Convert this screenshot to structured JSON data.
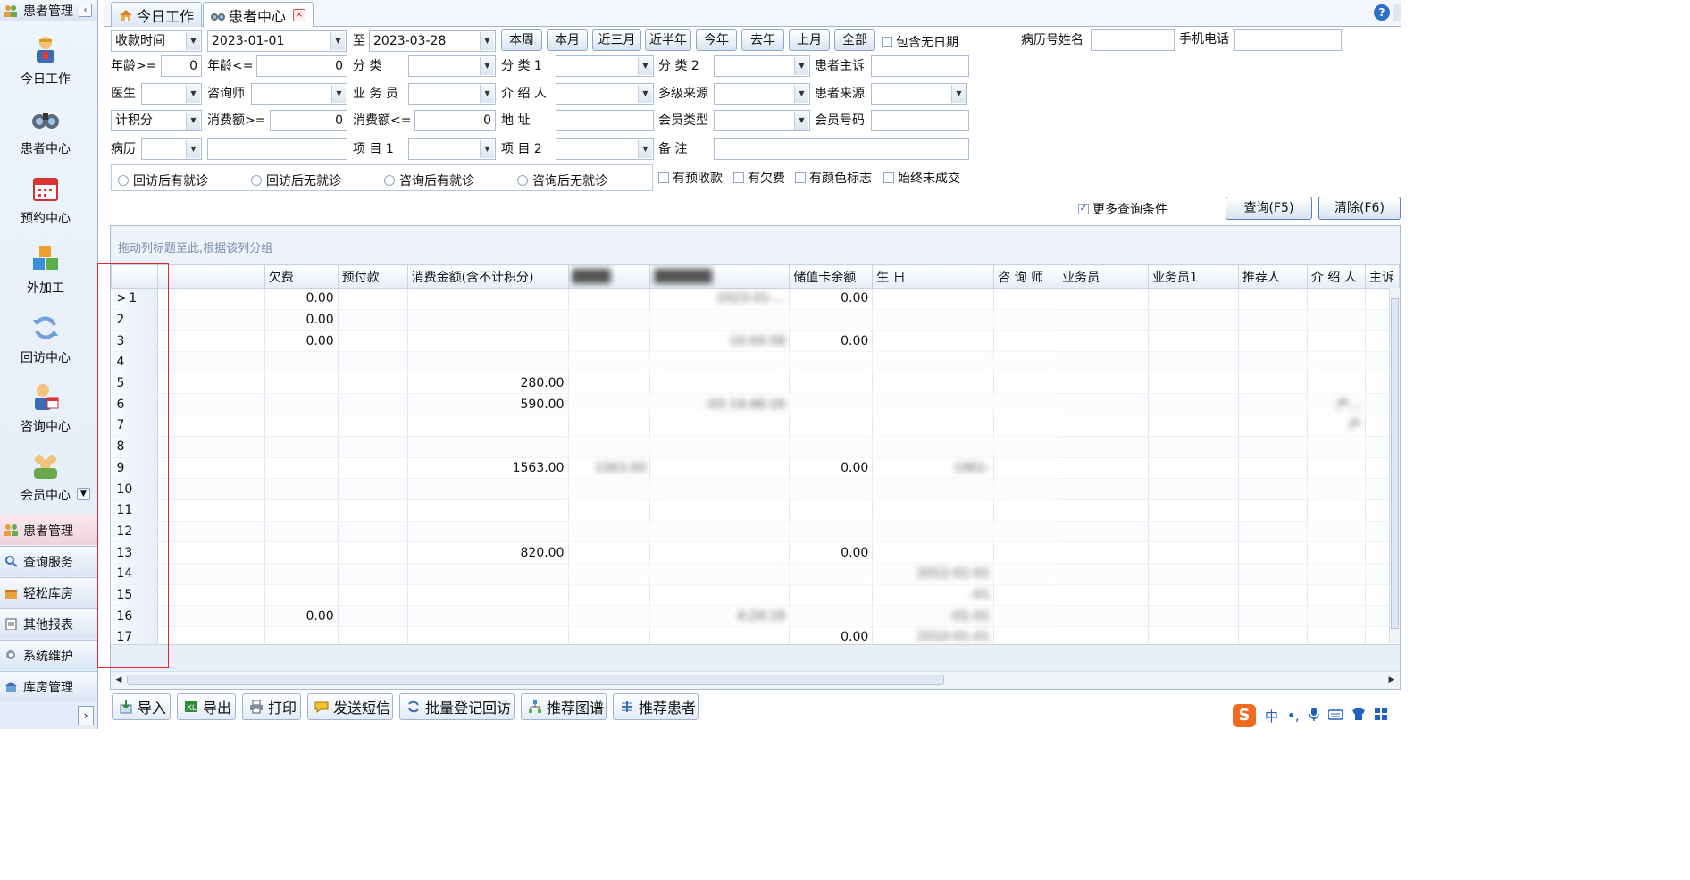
{
  "sidebar": {
    "title": "患者管理",
    "collapse_glyph": "‹",
    "big_items": [
      {
        "label": "今日工作",
        "icon": "worker-icon"
      },
      {
        "label": "患者中心",
        "icon": "binoculars-icon"
      },
      {
        "label": "预约中心",
        "icon": "calendar-icon"
      },
      {
        "label": "外加工",
        "icon": "cubes-icon"
      },
      {
        "label": "回访中心",
        "icon": "refresh-icon"
      },
      {
        "label": "咨询中心",
        "icon": "consultant-icon"
      },
      {
        "label": "会员中心",
        "icon": "members-icon"
      }
    ],
    "sections": [
      {
        "label": "患者管理",
        "active": true
      },
      {
        "label": "查询服务",
        "active": false
      },
      {
        "label": "轻松库房",
        "active": false
      },
      {
        "label": "其他报表",
        "active": false
      },
      {
        "label": "系统维护",
        "active": false
      },
      {
        "label": "库房管理",
        "active": false
      }
    ]
  },
  "tabs": [
    {
      "label": "今日工作",
      "icon": "home-icon",
      "active": false
    },
    {
      "label": "患者中心",
      "icon": "binoculars-icon",
      "active": true,
      "close_glyph": "×"
    }
  ],
  "help_glyph": "?",
  "query": {
    "date_type": "收款时间",
    "date_from": "2023-01-01",
    "to_label": "至",
    "date_to": "2023-03-28",
    "quick_ranges": [
      "本周",
      "本月",
      "近三月",
      "近半年",
      "今年",
      "去年",
      "上月",
      "全部"
    ],
    "include_no_date_label": "包含无日期",
    "record_name_label": "病历号姓名",
    "record_name_value": "",
    "phone_label": "手机电话",
    "phone_value": "",
    "age_gte_label": "年龄>=",
    "age_gte_value": "0",
    "age_lte_label": "年龄<=",
    "age_lte_value": "0",
    "category_label": "分  类",
    "category1_label": "分 类 1",
    "category2_label": "分 类 2",
    "complaint_label": "患者主诉",
    "doctor_label": "医生",
    "consultant_label": "咨询师",
    "salesman_label": "业 务 员",
    "referrer_label": "介 绍 人",
    "multi_source_label": "多级来源",
    "patient_source_label": "患者来源",
    "points_type": "计积分",
    "spend_gte_label": "消费额>=",
    "spend_gte_value": "0",
    "spend_lte_label": "消费额<=",
    "spend_lte_value": "0",
    "address_label": "地  址",
    "member_type_label": "会员类型",
    "member_no_label": "会员号码",
    "record_label": "病历",
    "item1_label": "项 目 1",
    "item2_label": "项 目 2",
    "remark_label": "备  注",
    "radios": [
      "回访后有就诊",
      "回访后无就诊",
      "咨询后有就诊",
      "咨询后无就诊"
    ],
    "flags": [
      "有预收款",
      "有欠费",
      "有颜色标志",
      "始终未成交"
    ],
    "more_conditions_label": "更多查询条件",
    "more_conditions_checked": "✓",
    "search_button": "查询(F5)",
    "clear_button": "清除(F6)"
  },
  "grid": {
    "group_hint": "拖动列标题至此,根据该列分组",
    "columns": [
      "",
      "",
      "欠费",
      "预付款",
      "消费金额(含不计积分)",
      "",
      "",
      "储值卡余额",
      "生  日",
      "咨 询 师",
      "业务员",
      "业务员1",
      "推荐人",
      "介 绍 人",
      "主诉"
    ],
    "current_row_marker": ">",
    "rows": [
      {
        "n": "1",
        "owe": "0.00",
        "prepay": "",
        "spend": "",
        "c5": "",
        "c6": "2023-01-...",
        "card": "0.00",
        "birthday": "",
        "consultant": "",
        "referrer": ""
      },
      {
        "n": "2",
        "owe": "0.00",
        "prepay": "",
        "spend": "",
        "c5": "",
        "c6": "",
        "card": "",
        "birthday": "",
        "consultant": "",
        "referrer": ""
      },
      {
        "n": "3",
        "owe": "0.00",
        "prepay": "",
        "spend": "",
        "c5": "",
        "c6": "10:44:58",
        "card": "0.00",
        "birthday": "",
        "consultant": "",
        "referrer": ""
      },
      {
        "n": "4",
        "owe": "",
        "prepay": "",
        "spend": "",
        "c5": "",
        "c6": "",
        "card": "",
        "birthday": "",
        "consultant": "",
        "referrer": ""
      },
      {
        "n": "5",
        "owe": "",
        "prepay": "",
        "spend": "280.00",
        "c5": "",
        "c6": "",
        "card": "",
        "birthday": "",
        "consultant": "",
        "referrer": ""
      },
      {
        "n": "6",
        "owe": "",
        "prepay": "",
        "spend": "590.00",
        "c5": "",
        "c6": "-03 14:46:16",
        "card": "",
        "birthday": "",
        "consultant": "",
        "referrer": "产..."
      },
      {
        "n": "7",
        "owe": "",
        "prepay": "",
        "spend": "",
        "c5": "",
        "c6": "",
        "card": "",
        "birthday": "",
        "consultant": "",
        "referrer": "产"
      },
      {
        "n": "8",
        "owe": "",
        "prepay": "",
        "spend": "",
        "c5": "",
        "c6": "",
        "card": "",
        "birthday": "",
        "consultant": "",
        "referrer": ""
      },
      {
        "n": "9",
        "owe": "",
        "prepay": "",
        "spend": "1563.00",
        "c5": "1563.00",
        "c6": "",
        "card": "0.00",
        "birthday": "1961-",
        "consultant": "",
        "referrer": ""
      },
      {
        "n": "10",
        "owe": "",
        "prepay": "",
        "spend": "",
        "c5": "",
        "c6": "",
        "card": "",
        "birthday": "",
        "consultant": "",
        "referrer": ""
      },
      {
        "n": "11",
        "owe": "",
        "prepay": "",
        "spend": "",
        "c5": "",
        "c6": "",
        "card": "",
        "birthday": "",
        "consultant": "",
        "referrer": ""
      },
      {
        "n": "12",
        "owe": "",
        "prepay": "",
        "spend": "",
        "c5": "",
        "c6": "",
        "card": "",
        "birthday": "",
        "consultant": "",
        "referrer": ""
      },
      {
        "n": "13",
        "owe": "",
        "prepay": "",
        "spend": "820.00",
        "c5": "",
        "c6": "",
        "card": "0.00",
        "birthday": "",
        "consultant": "",
        "referrer": ""
      },
      {
        "n": "14",
        "owe": "",
        "prepay": "",
        "spend": "",
        "c5": "",
        "c6": "",
        "card": "",
        "birthday": "2012-01-01",
        "consultant": "",
        "referrer": ""
      },
      {
        "n": "15",
        "owe": "",
        "prepay": "",
        "spend": "",
        "c5": "",
        "c6": "",
        "card": "",
        "birthday": "-01",
        "consultant": "",
        "referrer": ""
      },
      {
        "n": "16",
        "owe": "0.00",
        "prepay": "",
        "spend": "",
        "c5": "",
        "c6": "4:24:19",
        "card": "",
        "birthday": "-01-01",
        "consultant": "",
        "referrer": ""
      },
      {
        "n": "17",
        "owe": "",
        "prepay": "",
        "spend": "",
        "c5": "",
        "c6": "",
        "card": "0.00",
        "birthday": "2010-01-01",
        "consultant": "",
        "referrer": ""
      }
    ]
  },
  "toolbar": [
    {
      "label": "导入",
      "icon": "import-icon"
    },
    {
      "label": "导出",
      "icon": "export-excel-icon"
    },
    {
      "label": "打印",
      "icon": "printer-icon"
    },
    {
      "label": "发送短信",
      "icon": "sms-icon"
    },
    {
      "label": "批量登记回访",
      "icon": "batch-revisit-icon"
    },
    {
      "label": "推荐图谱",
      "icon": "referral-tree-icon"
    },
    {
      "label": "推荐患者",
      "icon": "recommend-patient-icon"
    }
  ],
  "ime": {
    "logo": "S",
    "lang": "中",
    "punct": "•,"
  },
  "colors": {
    "accent": "#2c6fc9",
    "selection_outline": "#e0262e",
    "sidebar_active": "#f0d3df"
  }
}
